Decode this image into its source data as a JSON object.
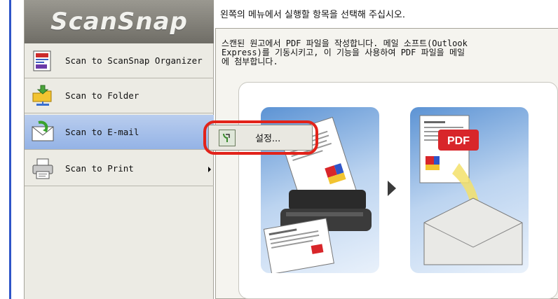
{
  "app": {
    "logo_text": "ScanSnap",
    "instruction": "왼쪽의 메뉴에서 실행할 항목을 선택해 주십시오."
  },
  "menu": {
    "items": [
      {
        "label": "Scan to ScanSnap Organizer",
        "icon": "scansnap-organizer-icon",
        "selected": false,
        "has_submenu": false
      },
      {
        "label": "Scan to Folder",
        "icon": "folder-network-icon",
        "selected": false,
        "has_submenu": false
      },
      {
        "label": "Scan to E-mail",
        "icon": "email-icon",
        "selected": true,
        "has_submenu": false
      },
      {
        "label": "Scan to Print",
        "icon": "printer-icon",
        "selected": false,
        "has_submenu": true
      }
    ]
  },
  "description": {
    "lines": [
      "스캔된 원고에서 PDF 파일을 작성합니다. 메일 소프트(Outlook",
      "Express)를 기동시키고, 이 기능을 사용하여 PDF 파일을 메일",
      "에 첨부합니다."
    ]
  },
  "illustration": {
    "pdf_badge": "PDF"
  },
  "settings_button": {
    "label": "설정...",
    "icon": "settings-wrench-icon"
  },
  "colors": {
    "selected_item": "#a7c0eb",
    "highlight_ring": "#e2231a",
    "accent_edge": "#2f55c8"
  }
}
